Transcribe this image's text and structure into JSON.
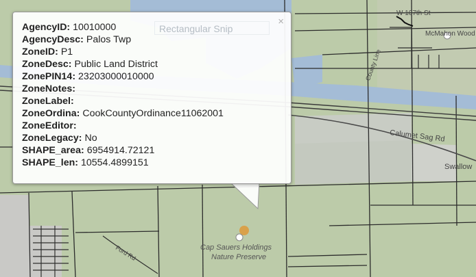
{
  "map": {
    "labels": {
      "street_107th": "W 107th St",
      "mcmahon": "McMahon Wood",
      "calumet": "Calumet Sag Rd",
      "swallow": "Swallow",
      "preserve_line1": "Cap Sauers Holdings",
      "preserve_line2": "Nature Preserve",
      "ford": "Ford Rd",
      "county_line": "County Line"
    },
    "colors": {
      "land": "#bccba9",
      "water": "#a4bcd6",
      "road": "#2b2b2b",
      "highlight": "#d9a14a"
    }
  },
  "popup": {
    "overlay_text": "Rectangular Snip",
    "close_glyph": "×",
    "fields": [
      {
        "key": "AgencyID:",
        "value": "10010000"
      },
      {
        "key": "AgencyDesc:",
        "value": "Palos Twp"
      },
      {
        "key": "ZoneID:",
        "value": "P1"
      },
      {
        "key": "ZoneDesc:",
        "value": "Public Land District"
      },
      {
        "key": "ZonePIN14:",
        "value": "23203000010000"
      },
      {
        "key": "ZoneNotes:",
        "value": ""
      },
      {
        "key": "ZoneLabel:",
        "value": ""
      },
      {
        "key": "ZoneOrdina:",
        "value": "CookCountyOrdinance11062001"
      },
      {
        "key": "ZoneEditor:",
        "value": ""
      },
      {
        "key": "ZoneLegacy:",
        "value": "No"
      },
      {
        "key": "SHAPE_area:",
        "value": "6954914.72121"
      },
      {
        "key": "SHAPE_len:",
        "value": "10554.4899151"
      }
    ]
  }
}
